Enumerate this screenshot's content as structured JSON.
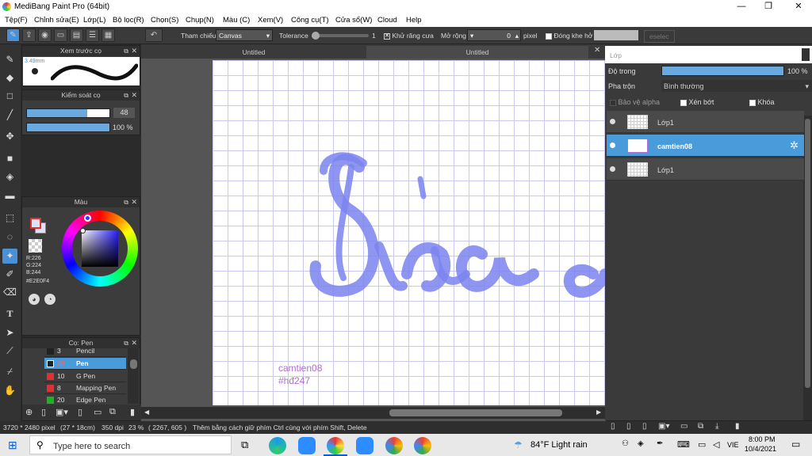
{
  "window": {
    "title": "MediBang Paint Pro (64bit)"
  },
  "menu": [
    "Tệp(F)",
    "Chỉnh sửa(E)",
    "Lớp(L)",
    "Bộ lọc(R)",
    "Chọn(S)",
    "Chụp(N)",
    "Màu (C)",
    "Xem(V)",
    "Công cụ(T)",
    "Cửa sổ(W)",
    "Cloud",
    "Help"
  ],
  "toolbar": {
    "ref_label": "Tham chiếu",
    "ref_value": "Canvas",
    "tolerance_label": "Tolerance",
    "tolerance_value": "1",
    "antialias_label": "Khử răng cưa",
    "expand_label": "Mở rộng",
    "expand_value": "0",
    "expand_unit": "pixel",
    "close_gap_label": "Đóng khe hở",
    "select_btn": "eselec"
  },
  "brush_preview": {
    "title": "Xem trước cọ",
    "size_text": "3.49mm"
  },
  "brush_control": {
    "title": "Kiểm soát cọ",
    "size_value": "48",
    "opacity_value": "100 %",
    "size_fraction": 0.73,
    "opacity_fraction": 1.0
  },
  "color_panel": {
    "title": "Màu",
    "r": "R:226",
    "g": "G:224",
    "b": "B:244",
    "hex": "#E2E0F4"
  },
  "brush_list": {
    "title": "Cọ: Pen",
    "items": [
      {
        "num": "3",
        "name": "Pencil",
        "color": "#222222"
      },
      {
        "num": "48",
        "name": "Pen",
        "color": "#222222"
      },
      {
        "num": "10",
        "name": "G Pen",
        "color": "#e03030"
      },
      {
        "num": "8",
        "name": "Mapping Pen",
        "color": "#e03030"
      },
      {
        "num": "20",
        "name": "Edge Pen",
        "color": "#20b020"
      }
    ]
  },
  "tabs": [
    "Untitled",
    "Untitled"
  ],
  "canvas": {
    "watermark_line1": "camtien08",
    "watermark_line2": "#hđ247"
  },
  "layer_panel": {
    "title": "Lớp",
    "opacity_label": "Độ trong",
    "opacity_value": "100 %",
    "opacity_fraction": 1.0,
    "blend_label": "Pha trộn",
    "blend_value": "Bình thường",
    "protect_alpha": "Bảo vệ alpha",
    "clipping": "Xén bớt",
    "lock": "Khóa",
    "layers": [
      {
        "name": "Lớp1"
      },
      {
        "name": "camtien08"
      },
      {
        "name": "Lớp1"
      }
    ]
  },
  "status": {
    "size": "3720 * 2480 pixel",
    "cm": "(27 * 18cm)",
    "dpi": "350 dpi",
    "zoom": "23 %",
    "coords": "( 2267, 605 )",
    "hint": "Thêm bằng cách giữ phím Ctrl cùng với phím Shift, Delete"
  },
  "taskbar": {
    "search_placeholder": "Type here to search",
    "weather": "84°F  Light rain",
    "lang": "VIE",
    "time": "8:00 PM",
    "date": "10/4/2021"
  }
}
